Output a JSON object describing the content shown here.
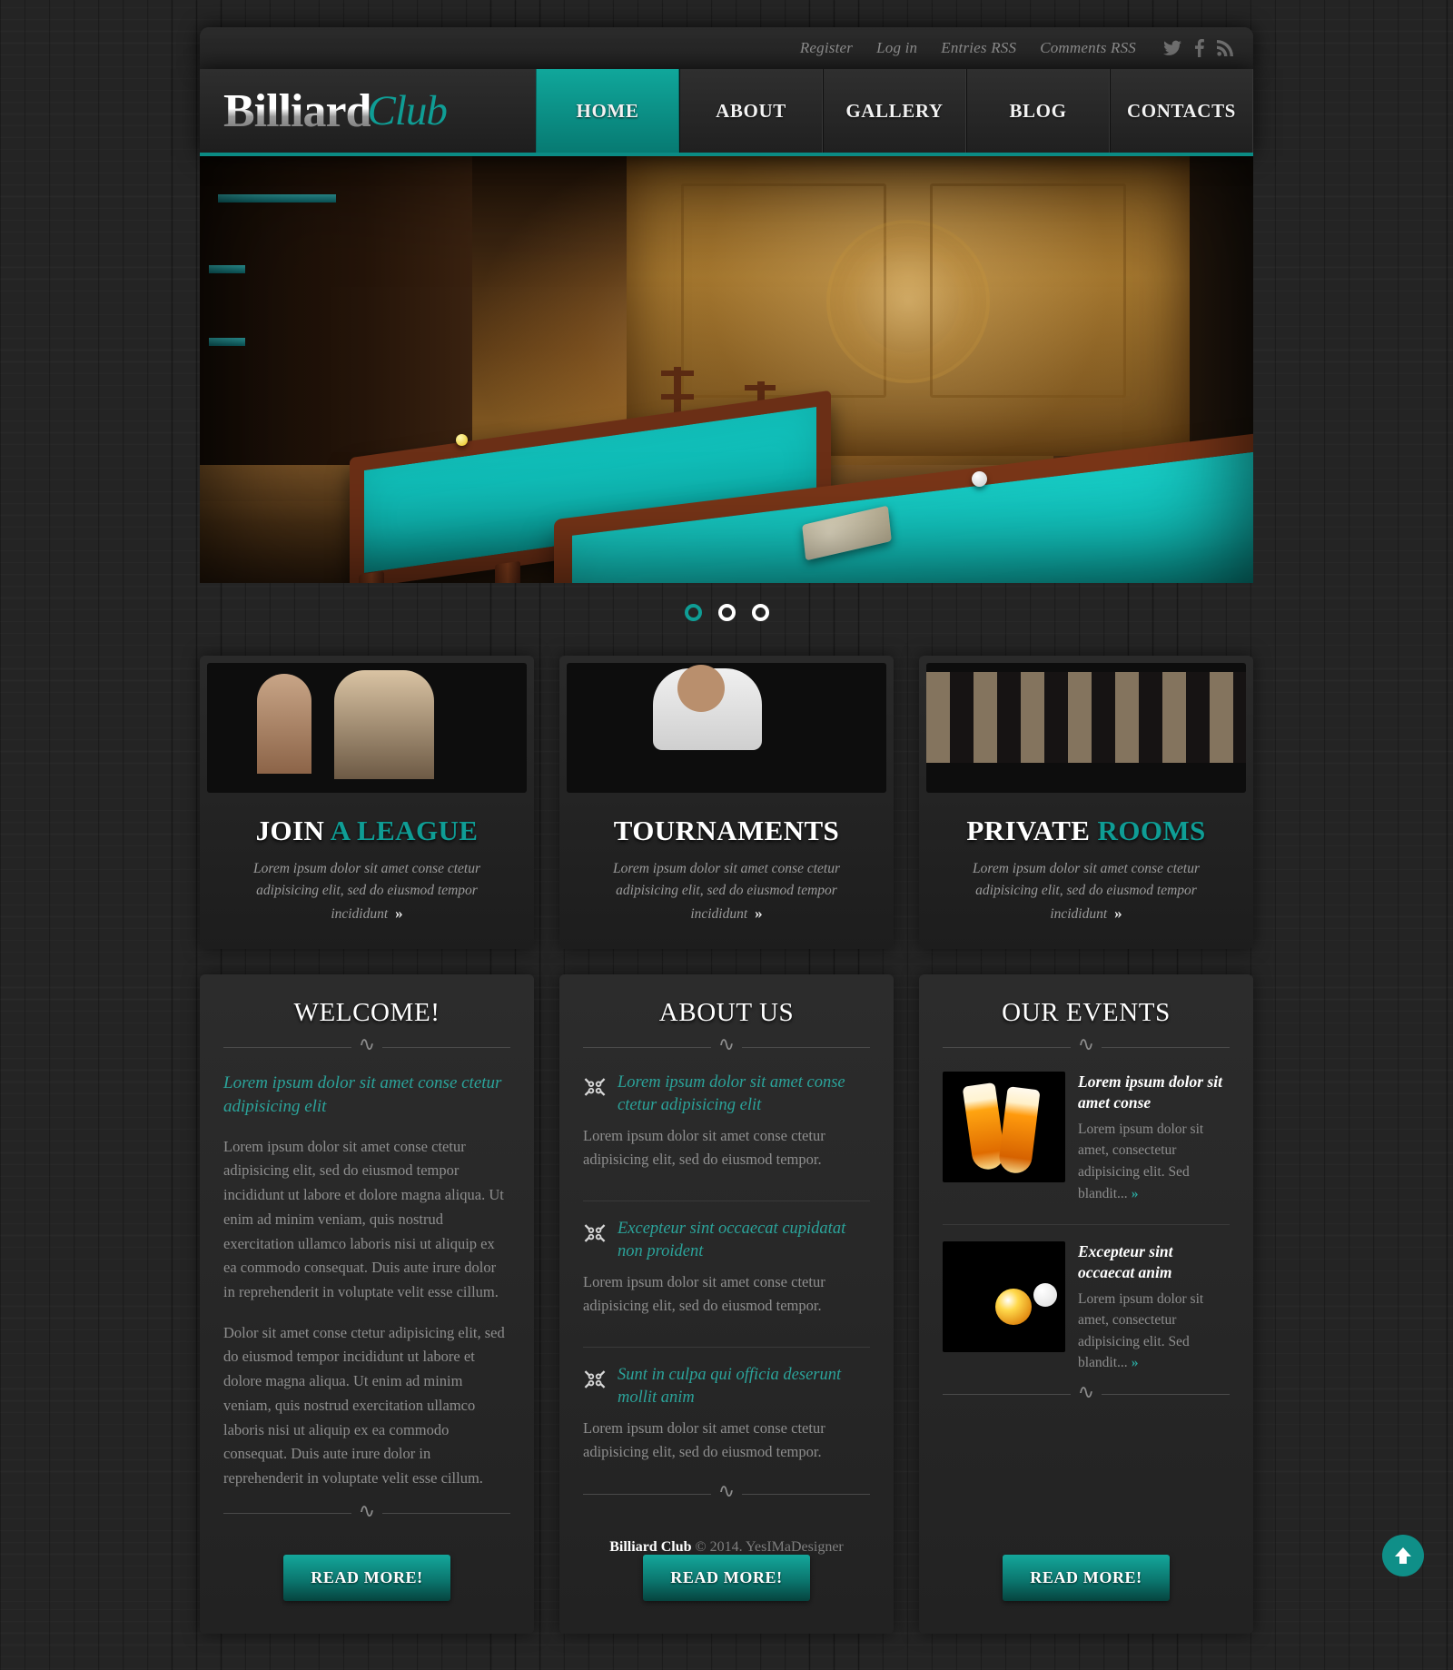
{
  "topbar": {
    "links": [
      {
        "label": "Register",
        "name": "register-link"
      },
      {
        "label": "Log in",
        "name": "login-link"
      },
      {
        "label": "Entries RSS",
        "name": "entries-rss-link"
      },
      {
        "label": "Comments RSS",
        "name": "comments-rss-link"
      }
    ],
    "social": [
      {
        "name": "twitter-icon",
        "label": "Twitter"
      },
      {
        "name": "facebook-icon",
        "label": "Facebook"
      },
      {
        "name": "rss-icon",
        "label": "RSS"
      }
    ]
  },
  "logo": {
    "part1": "Billiard",
    "part2": "Club"
  },
  "nav": {
    "items": [
      {
        "label": "HOME",
        "active": true
      },
      {
        "label": "ABOUT",
        "active": false
      },
      {
        "label": "GALLERY",
        "active": false
      },
      {
        "label": "BLOG",
        "active": false
      },
      {
        "label": "CONTACTS",
        "active": false
      }
    ]
  },
  "slider": {
    "dots": [
      "1",
      "2",
      "3"
    ],
    "active_dot": 0
  },
  "features": [
    {
      "title_white": "JOIN",
      "title_teal": "A LEAGUE",
      "desc": "Lorem ipsum dolor sit amet conse ctetur adipisicing elit, sed do eiusmod tempor incididunt",
      "arrows": "»",
      "image_name": "join-a-league-photo"
    },
    {
      "title_white": "TOURNAMENTS",
      "title_teal": "",
      "desc": "Lorem ipsum dolor sit amet conse ctetur adipisicing elit, sed do eiusmod tempor incididunt",
      "arrows": "»",
      "image_name": "tournaments-photo"
    },
    {
      "title_white": "PRIVATE",
      "title_teal": "ROOMS",
      "desc": "Lorem ipsum dolor sit amet conse ctetur adipisicing elit, sed do eiusmod tempor incididunt",
      "arrows": "»",
      "image_name": "private-rooms-photo"
    }
  ],
  "welcome": {
    "heading": "WELCOME!",
    "lead": "Lorem ipsum dolor sit amet conse ctetur adipisicing elit",
    "paragraph1": "Lorem ipsum dolor sit amet conse ctetur adipisicing elit, sed do eiusmod tempor incididunt ut labore et dolore magna aliqua. Ut enim ad minim veniam, quis nostrud exercitation ullamco laboris nisi ut aliquip ex ea commodo consequat. Duis aute irure dolor in reprehenderit in voluptate velit esse cillum.",
    "paragraph2": "Dolor sit amet conse ctetur adipisicing elit, sed do eiusmod tempor incididunt ut labore et dolore magna aliqua. Ut enim ad minim veniam, quis nostrud exercitation ullamco laboris nisi ut aliquip ex ea commodo consequat. Duis aute irure dolor in reprehenderit in voluptate velit esse cillum.",
    "button": "READ MORE!"
  },
  "about": {
    "heading": "ABOUT US",
    "items": [
      {
        "title": "Lorem ipsum dolor sit amet conse ctetur adipisicing elit",
        "body": "Lorem ipsum dolor sit amet conse ctetur adipisicing elit, sed do eiusmod tempor."
      },
      {
        "title": "Excepteur sint occaecat cupidatat non proident",
        "body": "Lorem ipsum dolor sit amet conse ctetur adipisicing elit, sed do eiusmod tempor."
      },
      {
        "title": "Sunt in culpa qui officia deserunt mollit anim",
        "body": "Lorem ipsum dolor sit amet conse ctetur adipisicing elit, sed do eiusmod tempor."
      }
    ],
    "button": "READ MORE!"
  },
  "events": {
    "heading": "OUR EVENTS",
    "items": [
      {
        "title": "Lorem ipsum dolor sit amet conse",
        "body": "Lorem ipsum dolor sit amet, consectetur adipisicing elit. Sed blandit...",
        "arrows": "»",
        "image_name": "beer-glasses-photo"
      },
      {
        "title": "Excepteur sint occaecat anim",
        "body": "Lorem ipsum dolor sit amet, consectetur adipisicing elit. Sed blandit...",
        "arrows": "»",
        "image_name": "nine-ball-photo"
      }
    ],
    "button": "READ MORE!"
  },
  "footer": {
    "brand": "Billiard Club",
    "copyright": " © 2014. ",
    "author": "YesIMaDesigner"
  },
  "colors": {
    "accent_teal": "#0f9d95",
    "accent_teal_light": "#14a79b",
    "page_bg": "#242424",
    "panel_bg": "#2a2a2a",
    "body_text": "#8e8e8e",
    "heading_text": "#ffffff"
  }
}
